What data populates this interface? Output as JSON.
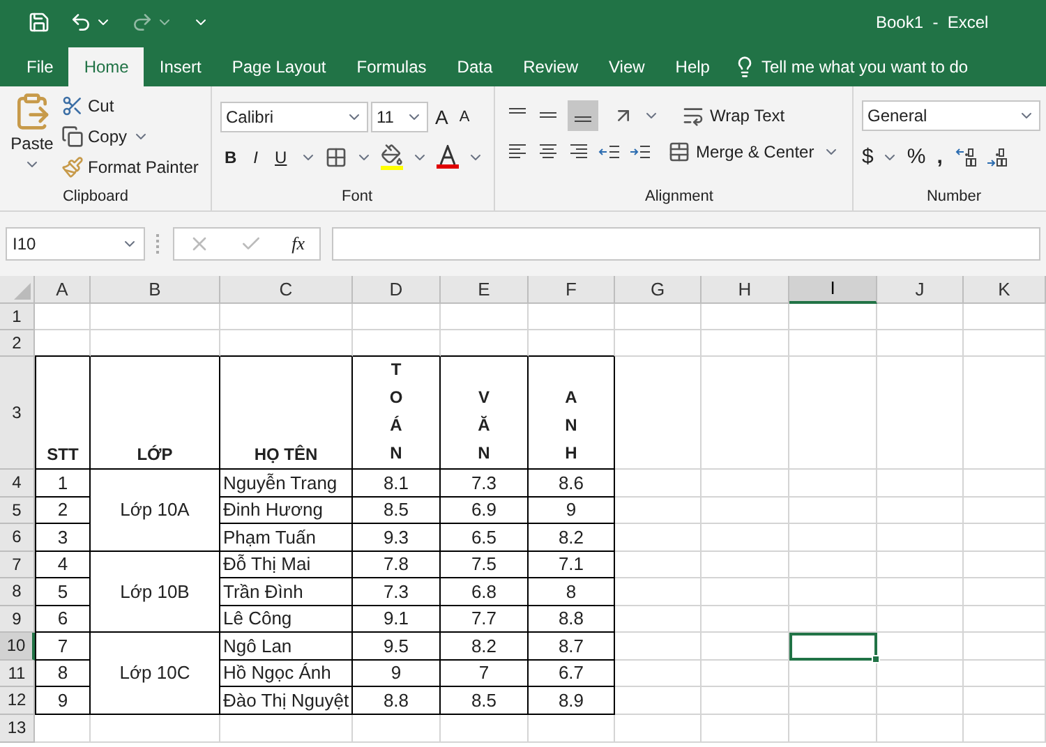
{
  "window": {
    "title": "Book1  -  Excel"
  },
  "tabs": [
    {
      "label": "File",
      "selected": false
    },
    {
      "label": "Home",
      "selected": true
    },
    {
      "label": "Insert",
      "selected": false
    },
    {
      "label": "Page Layout",
      "selected": false
    },
    {
      "label": "Formulas",
      "selected": false
    },
    {
      "label": "Data",
      "selected": false
    },
    {
      "label": "Review",
      "selected": false
    },
    {
      "label": "View",
      "selected": false
    },
    {
      "label": "Help",
      "selected": false
    }
  ],
  "tell_me": "Tell me what you want to do",
  "ribbon": {
    "clipboard": {
      "paste": "Paste",
      "cut": "Cut",
      "copy": "Copy",
      "format_painter": "Format Painter",
      "label": "Clipboard"
    },
    "font": {
      "font_name": "Calibri",
      "font_size": "11",
      "grow": "A",
      "shrink": "A",
      "bold": "B",
      "italic": "I",
      "underline": "U",
      "label": "Font"
    },
    "alignment": {
      "wrap_text": "Wrap Text",
      "merge_center": "Merge & Center",
      "label": "Alignment"
    },
    "number": {
      "format": "General",
      "currency": "$",
      "percent": "%",
      "comma": ",",
      "label": "Number"
    }
  },
  "formula_bar": {
    "name_box": "I10",
    "function_label": "fx"
  },
  "columns": [
    {
      "label": "A",
      "selected": false
    },
    {
      "label": "B",
      "selected": false
    },
    {
      "label": "C",
      "selected": false
    },
    {
      "label": "D",
      "selected": false
    },
    {
      "label": "E",
      "selected": false
    },
    {
      "label": "F",
      "selected": false
    },
    {
      "label": "G",
      "selected": false
    },
    {
      "label": "H",
      "selected": false
    },
    {
      "label": "I",
      "selected": true
    },
    {
      "label": "J",
      "selected": false
    },
    {
      "label": "K",
      "selected": false
    }
  ],
  "rows": [
    {
      "label": "1",
      "selected": false
    },
    {
      "label": "2",
      "selected": false
    },
    {
      "label": "3",
      "selected": false
    },
    {
      "label": "4",
      "selected": false
    },
    {
      "label": "5",
      "selected": false
    },
    {
      "label": "6",
      "selected": false
    },
    {
      "label": "7",
      "selected": false
    },
    {
      "label": "8",
      "selected": false
    },
    {
      "label": "9",
      "selected": false
    },
    {
      "label": "10",
      "selected": true
    },
    {
      "label": "11",
      "selected": false
    },
    {
      "label": "12",
      "selected": false
    },
    {
      "label": "13",
      "selected": false
    }
  ],
  "table": {
    "headers": [
      {
        "text": "STT",
        "vertical": false
      },
      {
        "text": "LỚP",
        "vertical": false
      },
      {
        "text": "HỌ TÊN",
        "vertical": false
      },
      {
        "text": "TOÁN",
        "vertical": true
      },
      {
        "text": "VĂN",
        "vertical": true
      },
      {
        "text": "ANH",
        "vertical": true
      }
    ],
    "groups": [
      {
        "class": "Lớp 10A",
        "students": [
          {
            "stt": "1",
            "name": "Nguyễn Trang",
            "scores": [
              "8.1",
              "7.3",
              "8.6"
            ]
          },
          {
            "stt": "2",
            "name": "Đinh Hương",
            "scores": [
              "8.5",
              "6.9",
              "9"
            ]
          },
          {
            "stt": "3",
            "name": "Phạm Tuấn",
            "scores": [
              "9.3",
              "6.5",
              "8.2"
            ]
          }
        ]
      },
      {
        "class": "Lớp 10B",
        "students": [
          {
            "stt": "4",
            "name": "Đỗ Thị Mai",
            "scores": [
              "7.8",
              "7.5",
              "7.1"
            ]
          },
          {
            "stt": "5",
            "name": "Trần Đình",
            "scores": [
              "7.3",
              "6.8",
              "8"
            ]
          },
          {
            "stt": "6",
            "name": "Lê Công",
            "scores": [
              "9.1",
              "7.7",
              "8.8"
            ]
          }
        ]
      },
      {
        "class": "Lớp 10C",
        "students": [
          {
            "stt": "7",
            "name": "Ngô Lan",
            "scores": [
              "9.5",
              "8.2",
              "8.7"
            ]
          },
          {
            "stt": "8",
            "name": "Hồ Ngọc Ánh",
            "scores": [
              "9",
              "7",
              "6.7"
            ]
          },
          {
            "stt": "9",
            "name": "Đào Thị Nguyệt",
            "scores": [
              "8.8",
              "8.5",
              "8.9"
            ]
          }
        ]
      }
    ]
  }
}
